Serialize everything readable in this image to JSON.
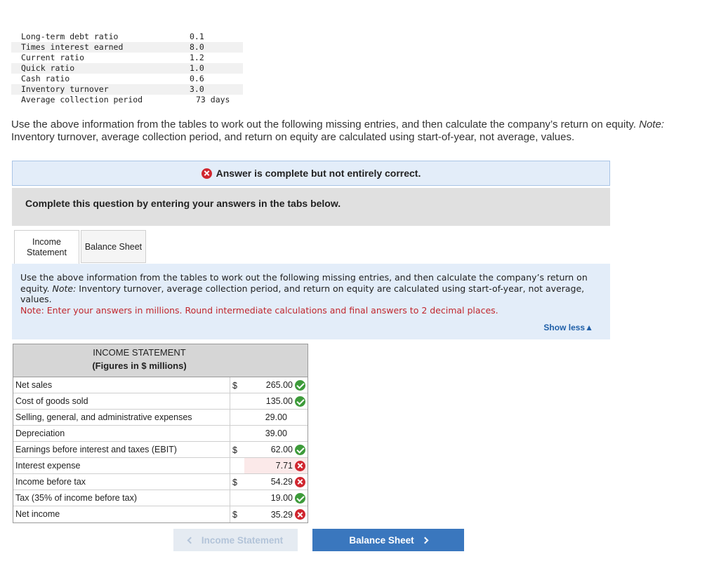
{
  "ratios": [
    {
      "label": "Long-term debt ratio",
      "value": "0.1"
    },
    {
      "label": "Times interest earned",
      "value": "8.0"
    },
    {
      "label": "Current ratio",
      "value": "1.2"
    },
    {
      "label": "Quick ratio",
      "value": "1.0"
    },
    {
      "label": "Cash ratio",
      "value": "0.6"
    },
    {
      "label": "Inventory turnover",
      "value": "3.0"
    },
    {
      "label": "Average collection period",
      "value": "73 days"
    }
  ],
  "intro": {
    "text": "Use the above information from the tables to work out the following missing entries, and then calculate the company’s return on equity. ",
    "note_label": "Note:",
    "note_text": " Inventory turnover, average collection period, and return on equity are calculated using start-of-year, not average, values."
  },
  "banner": {
    "text": "Answer is complete but not entirely correct."
  },
  "complete_text": "Complete this question by entering your answers in the tabs below.",
  "tabs": {
    "income_line1": "Income",
    "income_line2": "Statement",
    "balance": "Balance Sheet"
  },
  "instructions": {
    "text": "Use the above information from the tables to work out the following missing entries, and then calculate the company’s return on equity. ",
    "note_label": "Note:",
    "note_text": " Inventory turnover, average collection period, and return on equity are calculated using start-of-year, not average, values.",
    "note2": "Note: Enter your answers in millions. Round intermediate calculations and final answers to 2 decimal places.",
    "show_less": "Show less"
  },
  "income_statement": {
    "title": "INCOME STATEMENT",
    "subtitle": "(Figures in $ millions)",
    "rows": [
      {
        "label": "Net sales",
        "dollar": "$",
        "value": "265.00",
        "status": "correct"
      },
      {
        "label": "Cost of goods sold",
        "dollar": "",
        "value": "135.00",
        "status": "correct"
      },
      {
        "label": "Selling, general, and administrative expenses",
        "dollar": "",
        "value": "29.00",
        "status": "none"
      },
      {
        "label": "Depreciation",
        "dollar": "",
        "value": "39.00",
        "status": "none"
      },
      {
        "label": "Earnings before interest and taxes (EBIT)",
        "dollar": "$",
        "value": "62.00",
        "status": "correct"
      },
      {
        "label": "Interest expense",
        "dollar": "",
        "value": "7.71",
        "status": "incorrect"
      },
      {
        "label": "Income before tax",
        "dollar": "$",
        "value": "54.29",
        "status": "incorrect"
      },
      {
        "label": "Tax (35% of income before tax)",
        "dollar": "",
        "value": "19.00",
        "status": "correct"
      },
      {
        "label": "Net income",
        "dollar": "$",
        "value": "35.29",
        "status": "incorrect"
      }
    ]
  },
  "nav": {
    "prev": "Income Statement",
    "next": "Balance Sheet"
  },
  "colors": {
    "correct": "#3d9b3a",
    "incorrect": "#d0262f",
    "primary": "#3a77be",
    "banner_bg": "#e3edf9"
  }
}
